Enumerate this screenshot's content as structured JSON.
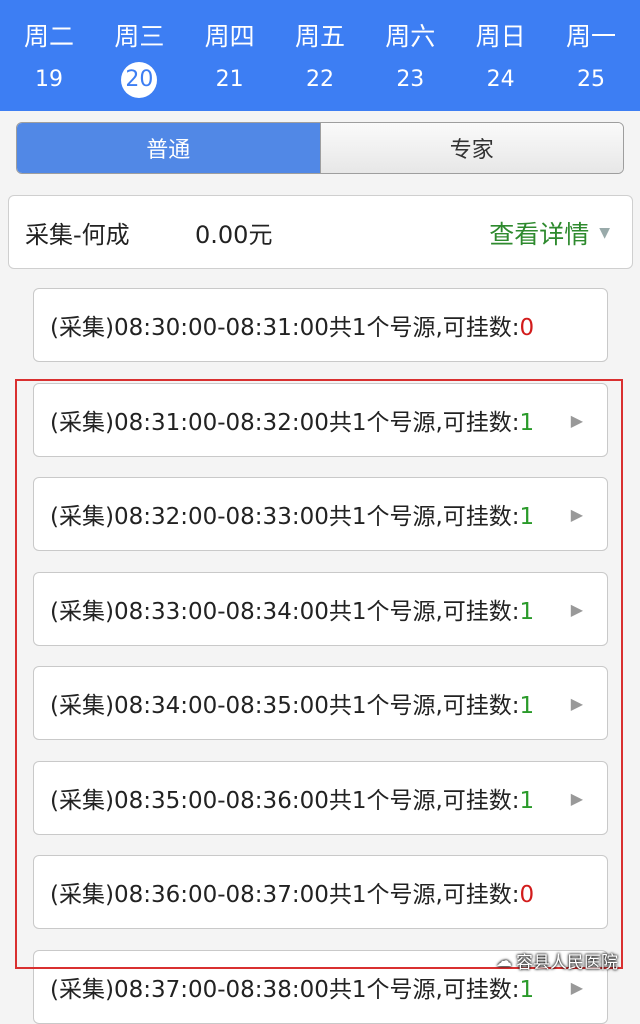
{
  "week": [
    {
      "weekday": "周二",
      "date": "19"
    },
    {
      "weekday": "周三",
      "date": "20"
    },
    {
      "weekday": "周四",
      "date": "21"
    },
    {
      "weekday": "周五",
      "date": "22"
    },
    {
      "weekday": "周六",
      "date": "23"
    },
    {
      "weekday": "周日",
      "date": "24"
    },
    {
      "weekday": "周一",
      "date": "25"
    }
  ],
  "tabs": {
    "normal": "普通",
    "expert": "专家"
  },
  "doctor": {
    "name": "采集-何成",
    "fee": "0.00元",
    "details_label": "查看详情"
  },
  "slots": [
    {
      "text": "(采集)08:30:00-08:31:00共1个号源,可挂数:",
      "count": "0"
    },
    {
      "text": "(采集)08:31:00-08:32:00共1个号源,可挂数:",
      "count": "1"
    },
    {
      "text": "(采集)08:32:00-08:33:00共1个号源,可挂数:",
      "count": "1"
    },
    {
      "text": "(采集)08:33:00-08:34:00共1个号源,可挂数:",
      "count": "1"
    },
    {
      "text": "(采集)08:34:00-08:35:00共1个号源,可挂数:",
      "count": "1"
    },
    {
      "text": "(采集)08:35:00-08:36:00共1个号源,可挂数:",
      "count": "1"
    },
    {
      "text": "(采集)08:36:00-08:37:00共1个号源,可挂数:",
      "count": "0"
    },
    {
      "text": "(采集)08:37:00-08:38:00共1个号源,可挂数:",
      "count": "1"
    }
  ],
  "watermark": "容县人民医院",
  "colors": {
    "header": "#3d7ef3",
    "available": "#2a9a2a",
    "unavailable": "#d21b1b",
    "details": "#2e8a2e"
  }
}
